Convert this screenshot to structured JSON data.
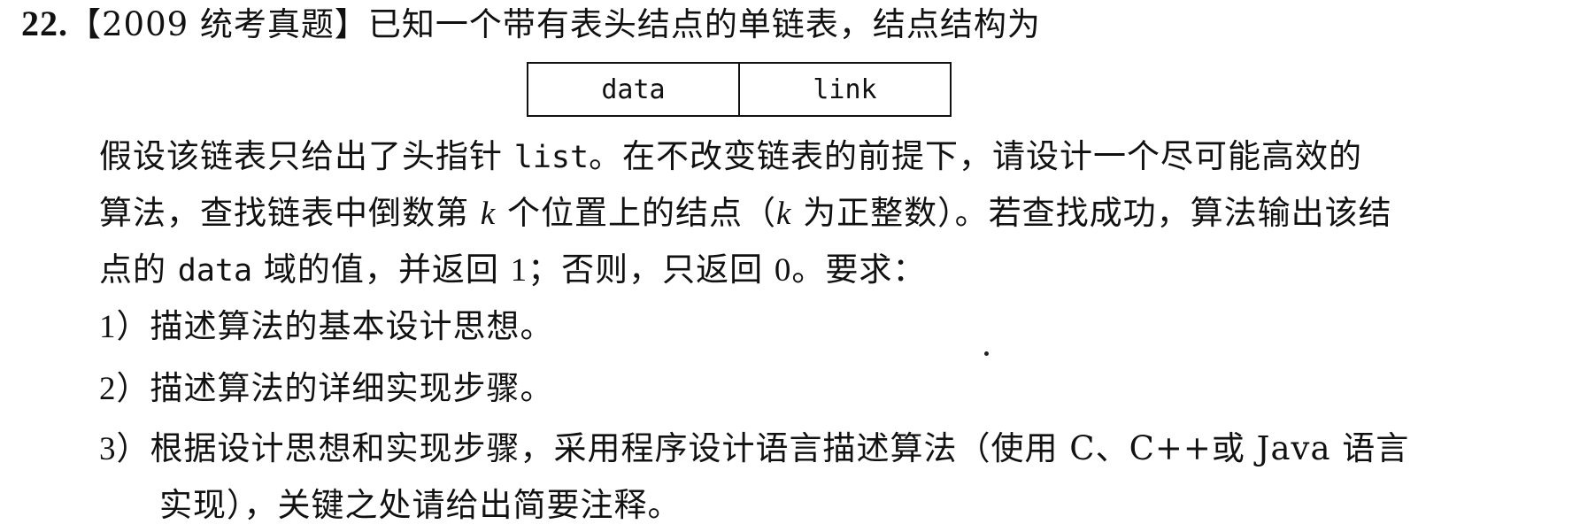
{
  "question": {
    "number": "22.",
    "title": "【2009 统考真题】已知一个带有表头结点的单链表，结点结构为"
  },
  "node_structure": {
    "field1": "data",
    "field2": "link"
  },
  "body": {
    "p1_a": "假设该链表只给出了头指针 ",
    "p1_code": "list",
    "p1_b": "。在不改变链表的前提下，请设计一个尽可能高效的",
    "p2_a": "算法，查找链表中倒数第 ",
    "p2_k1": "k",
    "p2_b": " 个位置上的结点（",
    "p2_k2": "k",
    "p2_c": " 为正整数）。若查找成功，算法输出该结",
    "p3_a": "点的 ",
    "p3_code": "data",
    "p3_b": " 域的值，并返回 ",
    "p3_one": "1",
    "p3_c": "；否则，只返回 ",
    "p3_zero": "0",
    "p3_d": "。要求："
  },
  "requirements": [
    {
      "num": "1）",
      "text": "描述算法的基本设计思想。"
    },
    {
      "num": "2）",
      "text": "描述算法的详细实现步骤。"
    },
    {
      "num": "3）",
      "text": "根据设计思想和实现步骤，采用程序设计语言描述算法（使用 C、C++或 Java 语言"
    }
  ],
  "requirement3_cont": "实现），关键之处请给出简要注释。"
}
